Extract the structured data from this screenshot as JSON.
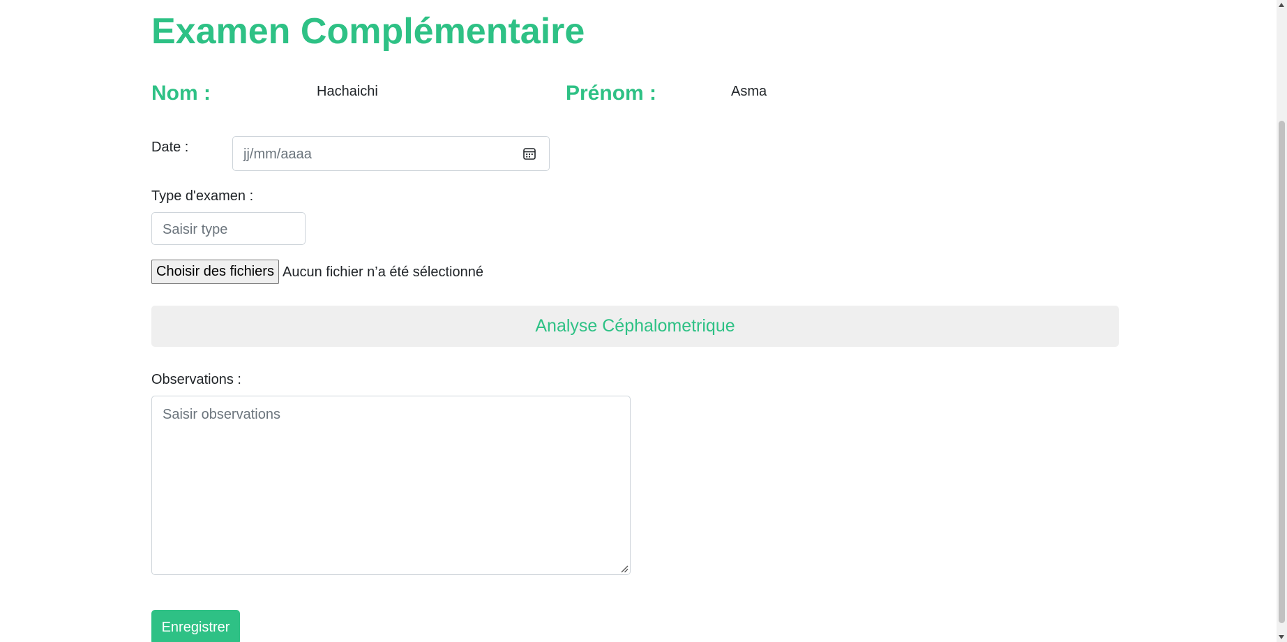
{
  "page_title": "Examen Complémentaire",
  "patient": {
    "nom_label": "Nom :",
    "nom_value": "Hachaichi",
    "prenom_label": "Prénom :",
    "prenom_value": "Asma"
  },
  "form": {
    "date_label": "Date :",
    "date_placeholder": "jj/mm/aaaa",
    "type_label": "Type d'examen :",
    "type_placeholder": "Saisir type",
    "file_button_label": "Choisir des fichiers",
    "file_status": "Aucun fichier n’a été sélectionné",
    "analyse_label": "Analyse Céphalometrique",
    "observations_label": "Observations :",
    "observations_placeholder": "Saisir observations",
    "save_label": "Enregistrer"
  },
  "colors": {
    "accent": "#2ec185",
    "panel_bg": "#efefef"
  },
  "icons": {
    "date_picker": "calendar-icon",
    "textarea_resize": "resize-handle-icon"
  }
}
